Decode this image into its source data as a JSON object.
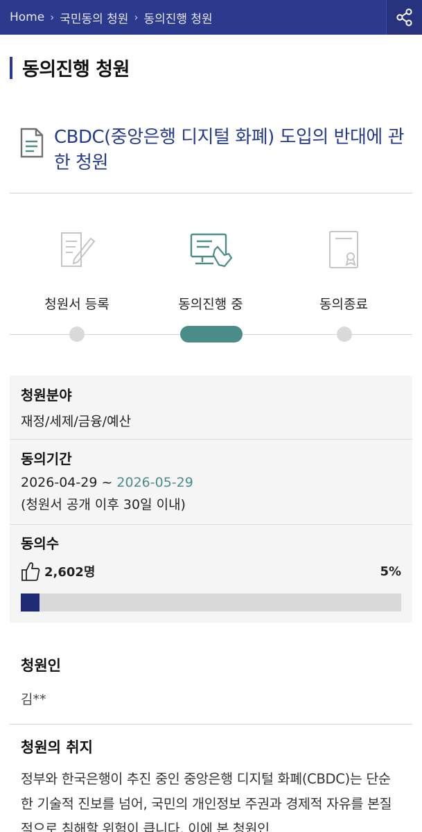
{
  "breadcrumb": {
    "items": [
      "Home",
      "국민동의 청원",
      "동의진행 청원"
    ]
  },
  "header": {
    "share_icon": "share-icon"
  },
  "section": {
    "title": "동의진행 청원"
  },
  "petition": {
    "title": "CBDC(중앙은행 디지털 화폐) 도입의 반대에 관한 청원"
  },
  "steps": [
    {
      "label": "청원서 등록",
      "icon": "document-pen-icon"
    },
    {
      "label": "동의진행 중",
      "icon": "computer-click-icon"
    },
    {
      "label": "동의종료",
      "icon": "certificate-icon"
    }
  ],
  "current_step": 2,
  "info": {
    "category_label": "청원분야",
    "category_value": "재정/세제/금융/예산",
    "period_label": "동의기간",
    "period_start": "2026-04-29",
    "period_sep": " ~ ",
    "period_end": "2026-05-29",
    "period_note": "(청원서 공개 이후 30일 이내)",
    "agree_label": "동의수",
    "agree_count": "2,602명",
    "agree_percent_text": "5%",
    "agree_progress": 0.05
  },
  "petitioner": {
    "label": "청원인",
    "value": "김**"
  },
  "purpose": {
    "label": "청원의 취지",
    "text": "정부와 한국은행이 추진 중인 중앙은행 디지털 화폐(CBDC)는 단순한 기술적 진보를 넘어, 국민의 개인정보 주권과 경제적 자유를 본질적으로 침해할 위험이 큽니다. 이에 본 청원인"
  },
  "colors": {
    "header_bg": "#2b3a8c",
    "title_blue": "#243a8c",
    "accent_teal": "#4a8c88",
    "progress_fill": "#1f2b75"
  }
}
